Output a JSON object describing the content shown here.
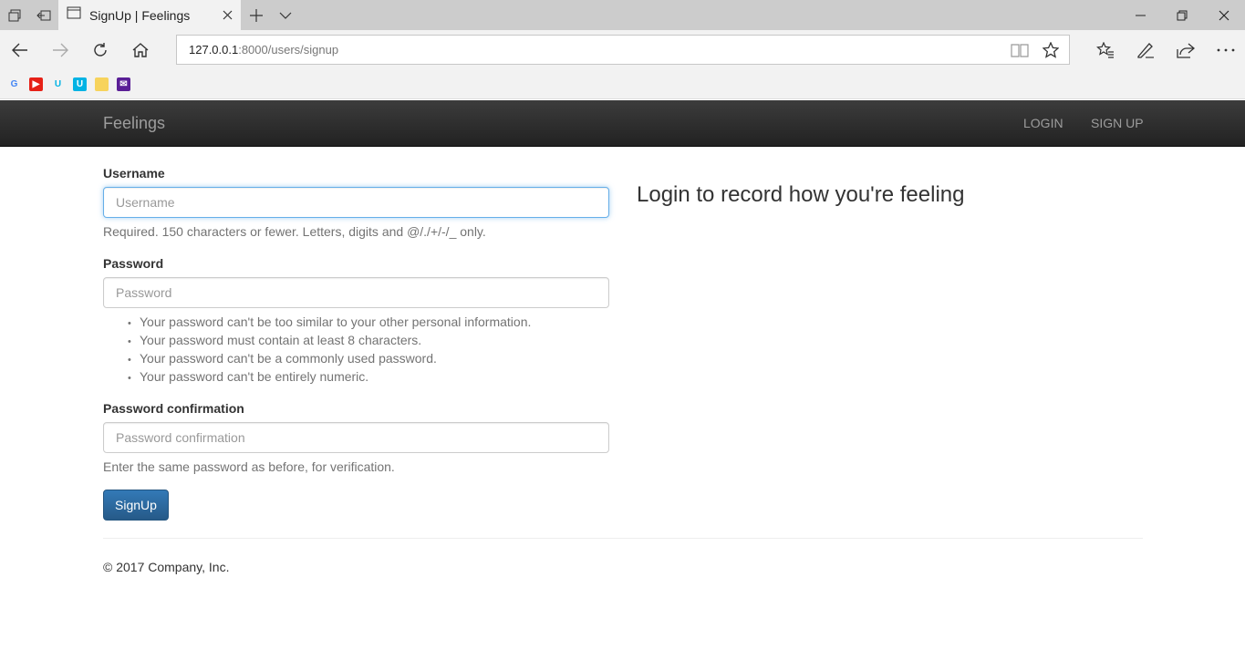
{
  "browser": {
    "tab_title": "SignUp | Feelings",
    "address": {
      "host": "127.0.0.1",
      "rest": ":8000/users/signup"
    },
    "favorites": [
      {
        "icon": "google-icon",
        "glyph": "G",
        "color": "#4285f4",
        "bg": "transparent"
      },
      {
        "icon": "youtube-icon",
        "glyph": "▶",
        "color": "#ffffff",
        "bg": "#e62117"
      },
      {
        "icon": "udacity-icon",
        "glyph": "U",
        "color": "#02b3e4",
        "bg": "transparent"
      },
      {
        "icon": "udacity-app-icon",
        "glyph": "U",
        "color": "#ffffff",
        "bg": "#02b3e4"
      },
      {
        "icon": "note-icon",
        "glyph": "",
        "color": "#f7d35c",
        "bg": "#f7d35c"
      },
      {
        "icon": "mail-icon",
        "glyph": "✉",
        "color": "#ffffff",
        "bg": "#5a1f96"
      }
    ]
  },
  "site": {
    "brand": "Feelings",
    "nav": {
      "login": "LOGIN",
      "signup": "SIGN UP"
    }
  },
  "form": {
    "username": {
      "label": "Username",
      "placeholder": "Username",
      "help": "Required. 150 characters or fewer. Letters, digits and @/./+/-/_ only."
    },
    "password": {
      "label": "Password",
      "placeholder": "Password",
      "rules": [
        "Your password can't be too similar to your other personal information.",
        "Your password must contain at least 8 characters.",
        "Your password can't be a commonly used password.",
        "Your password can't be entirely numeric."
      ]
    },
    "password_confirmation": {
      "label": "Password confirmation",
      "placeholder": "Password confirmation",
      "help": "Enter the same password as before, for verification."
    },
    "submit_label": "SignUp"
  },
  "side_heading": "Login to record how you're feeling",
  "footer": "© 2017 Company, Inc."
}
